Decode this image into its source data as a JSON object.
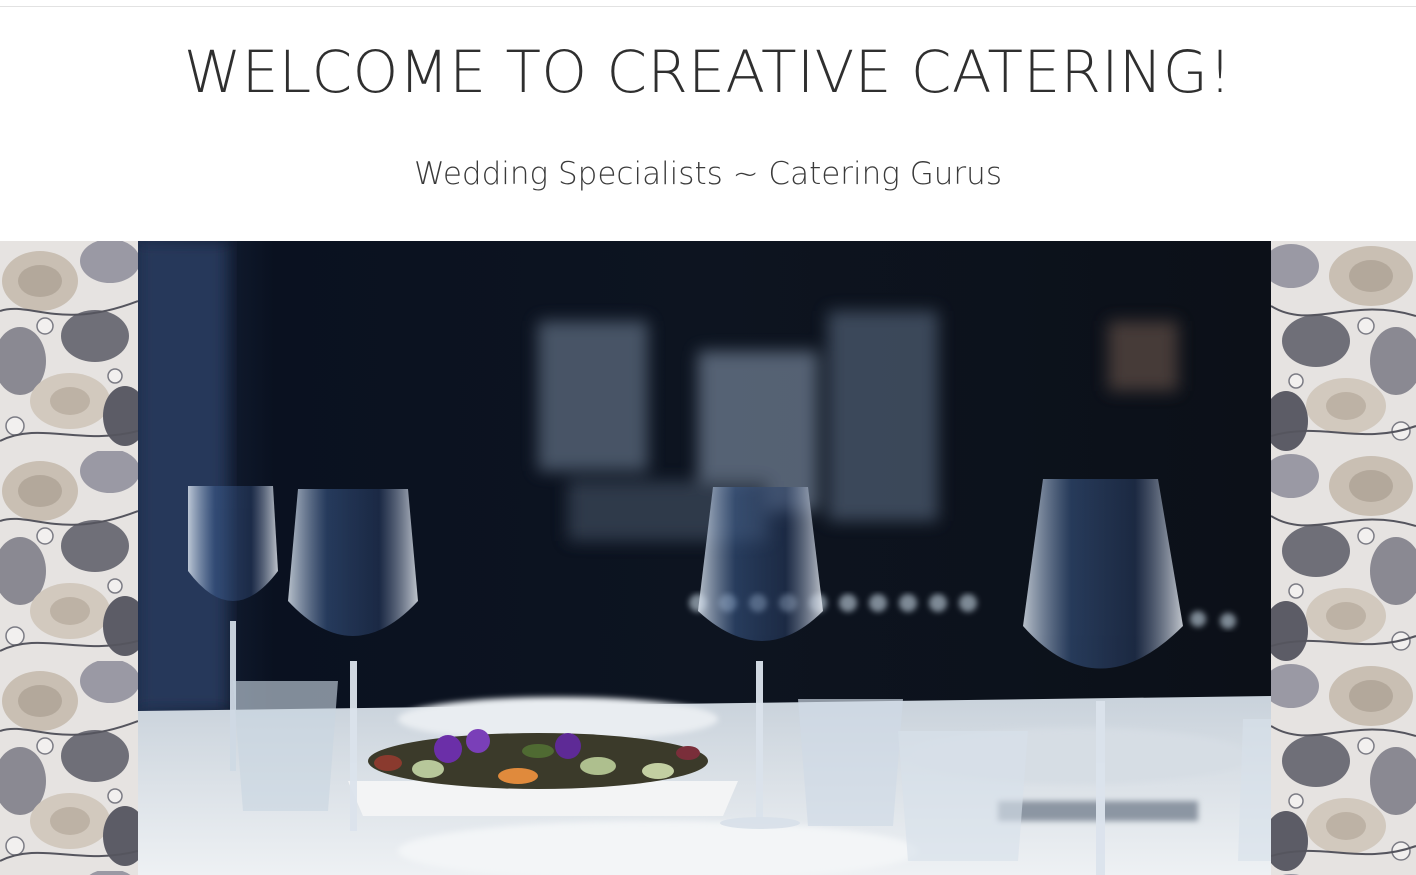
{
  "header": {
    "title": "WELCOME TO CREATIVE CATERING!",
    "tagline": "Wedding Specialists ~ Catering Gurus"
  },
  "banner": {
    "hero_image": "table-setting-wine-glasses-salad-photo",
    "side_pattern": "grey-beige-floral-wallpaper"
  },
  "colors": {
    "heading_text": "#2f2f2f",
    "background": "#ffffff",
    "hero_dark": "#0b1220",
    "floral_grey": "#6f6f78",
    "floral_beige": "#c9bfb3"
  }
}
